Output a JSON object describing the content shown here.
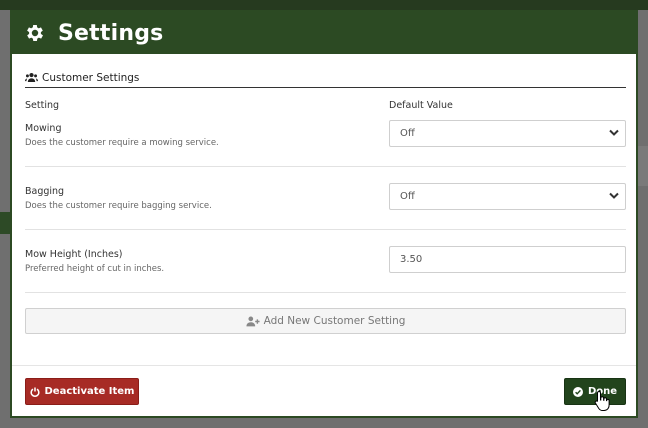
{
  "modal": {
    "title": "Settings",
    "icon": "gear-icon"
  },
  "section": {
    "title": "Customer Settings",
    "icon": "users-icon"
  },
  "columns": {
    "setting": "Setting",
    "default_value": "Default Value"
  },
  "settings": [
    {
      "label": "Mowing",
      "description": "Does the customer require a mowing service.",
      "control": "select",
      "value": "Off"
    },
    {
      "label": "Bagging",
      "description": "Does the customer require bagging service.",
      "control": "select",
      "value": "Off"
    },
    {
      "label": "Mow Height (Inches)",
      "description": "Preferred height of cut in inches.",
      "control": "text",
      "value": "3.50"
    }
  ],
  "actions": {
    "add_setting": "Add New Customer Setting",
    "deactivate": "Deactivate Item",
    "done": "Done"
  },
  "colors": {
    "header_bg": "#2c4a23",
    "deactivate_bg": "#a72b25",
    "done_bg": "#22441c"
  }
}
